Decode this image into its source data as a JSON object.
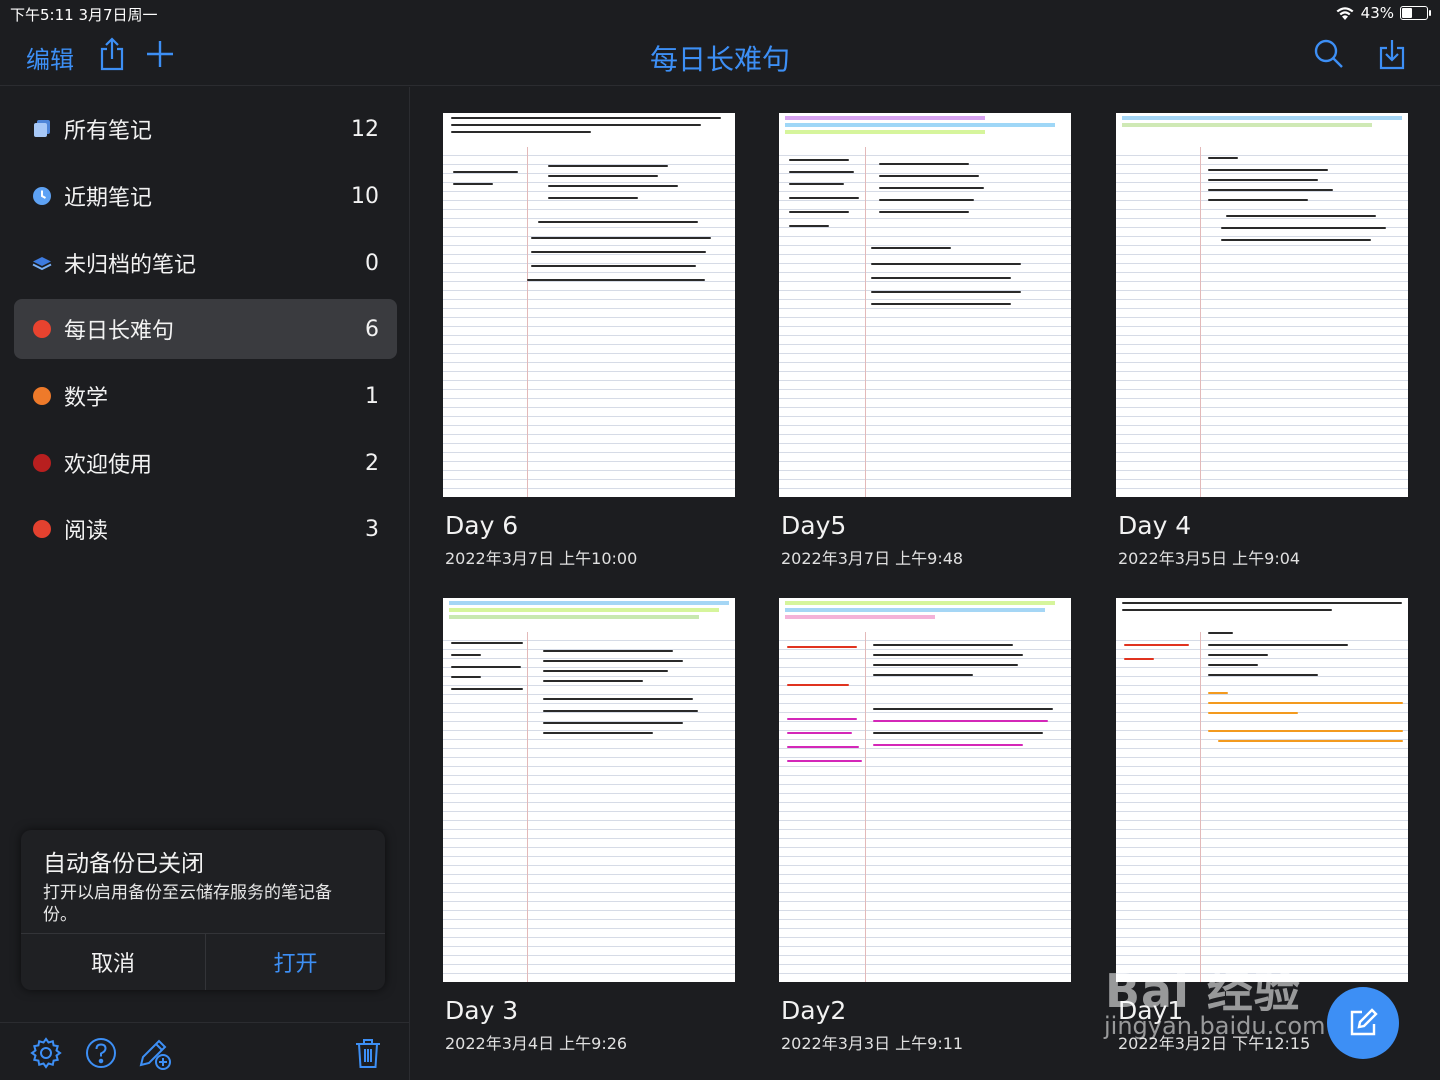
{
  "status_bar": {
    "time_date": "下午5:11   3月7日周一",
    "battery": "43%",
    "battery_level": 0.43
  },
  "toolbar": {
    "edit_label": "编辑",
    "title": "每日长难句"
  },
  "sidebar": {
    "items": [
      {
        "label": "所有笔记",
        "count": "12",
        "icon": "notes-stack-icon",
        "color": "#7ab1f7"
      },
      {
        "label": "近期笔记",
        "count": "10",
        "icon": "clock-icon",
        "color": "#5ea2f4"
      },
      {
        "label": "未归档的笔记",
        "count": "0",
        "icon": "layers-icon",
        "color": "#3d7be0"
      },
      {
        "label": "每日长难句",
        "count": "6",
        "icon": "dot",
        "color": "#e8432f"
      },
      {
        "label": "数学",
        "count": "1",
        "icon": "dot",
        "color": "#ee7a2a"
      },
      {
        "label": "欢迎使用",
        "count": "2",
        "icon": "dot",
        "color": "#b81f1f"
      },
      {
        "label": "阅读",
        "count": "3",
        "icon": "dot",
        "color": "#e3412f"
      }
    ],
    "backup": {
      "title": "自动备份已关闭",
      "description": "打开以启用备份至云储存服务的笔记备份。",
      "cancel_label": "取消",
      "open_label": "打开"
    }
  },
  "notes": [
    {
      "title": "Day 6",
      "date": "2022年3月7日 上午10:00"
    },
    {
      "title": "Day5",
      "date": "2022年3月7日 上午9:48"
    },
    {
      "title": "Day 4",
      "date": "2022年3月5日 上午9:04"
    },
    {
      "title": "Day 3",
      "date": "2022年3月4日 上午9:26"
    },
    {
      "title": "Day2",
      "date": "2022年3月3日 上午9:11"
    },
    {
      "title": "Day1",
      "date": "2022年3月2日 下午12:15"
    }
  ],
  "watermark": {
    "brand": "Bai 经验",
    "url": "jingyan.baidu.com"
  },
  "colors": {
    "accent": "#3d8ff5",
    "background": "#1c1d20",
    "active_row": "#3a3b3f"
  }
}
